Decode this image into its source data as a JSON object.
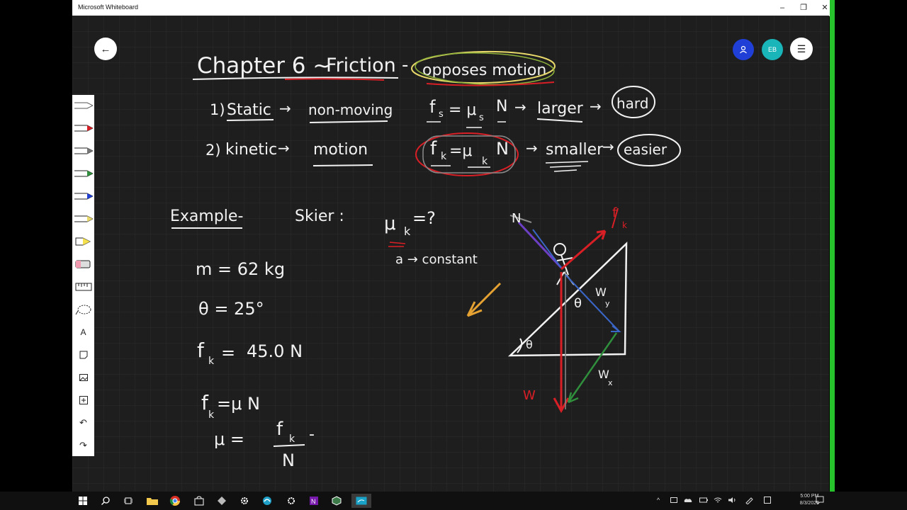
{
  "window": {
    "title": "Microsoft Whiteboard",
    "minimize": "–",
    "maximize": "❐",
    "close": "✕"
  },
  "participants": [
    {
      "initials": "",
      "color": "#1f3fd6"
    },
    {
      "initials": "EB",
      "color": "#19b5b8"
    }
  ],
  "board": {
    "heading": {
      "chapter": "Chapter 6 ~",
      "topic": "Friction",
      "dash": "-",
      "definition": "opposes motion"
    },
    "static_row": {
      "num": "1)",
      "kind": "Static",
      "arrow": "→",
      "desc": "non-moving",
      "formula_f": "f",
      "formula_sub": "s",
      "formula_eq": "= μ",
      "formula_msub": "s",
      "formula_n": "N",
      "result_arrow": "→",
      "result": "larger",
      "result_arrow2": "→",
      "outcome": "hard"
    },
    "kinetic_row": {
      "num": "2)",
      "kind": "kinetic",
      "arrow": "→",
      "desc": "motion",
      "formula_f": "f",
      "formula_sub": "k",
      "formula_eq": "=μ",
      "formula_msub": "k",
      "formula_n": "N",
      "result_arrow": "→",
      "result": "smaller",
      "result_arrow2": "→",
      "outcome": "easier"
    },
    "example": {
      "label": "Example-",
      "problem": "Skier :",
      "unknown": "μ",
      "unknown_sub": "k",
      "unknown_eq": "=?",
      "accel": "a → constant",
      "givens": [
        "m = 62 kg",
        "θ = 25°",
        "45.0 N"
      ],
      "fk_label": "f",
      "fk_sub": "k",
      "fk_eq": "=",
      "relation": "=μ N",
      "mu_lhs": "μ  =",
      "mu_num": "f",
      "mu_num_sub": "k",
      "mu_den": "N",
      "mu_dash": "-"
    },
    "diagram": {
      "normal": "N",
      "friction": "f",
      "friction_sub": "k",
      "theta_top": "θ",
      "theta_base": "θ",
      "wy": "W",
      "wy_sub": "y",
      "wx": "W",
      "wx_sub": "x",
      "weight": "W"
    },
    "colors": {
      "ink": "#f2f2f2",
      "red": "#d91f26",
      "yellow": "#e8d96a",
      "green": "#2f8f3c",
      "blue": "#3a66c8",
      "orange": "#e5a232",
      "purple": "#6c3fc4"
    }
  },
  "taskbar": {
    "time": "5:00 PM",
    "date": "8/3/2020"
  }
}
